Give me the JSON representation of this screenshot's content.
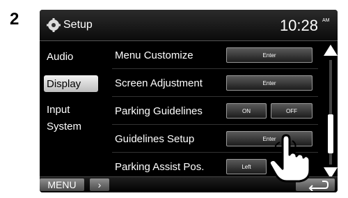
{
  "step": "2",
  "titlebar": {
    "title": "Setup",
    "time": "10:28",
    "ampm": "AM",
    "icon": "gear-icon"
  },
  "sidebar": {
    "items": [
      {
        "label": "Audio"
      },
      {
        "label": "Display",
        "selected": true
      },
      {
        "label": "Input"
      },
      {
        "label": "System"
      }
    ]
  },
  "list": {
    "rows": [
      {
        "label": "Menu Customize",
        "buttons": [
          "Enter"
        ]
      },
      {
        "label": "Screen Adjustment",
        "buttons": [
          "Enter"
        ]
      },
      {
        "label": "Parking Guidelines",
        "buttons": [
          "ON",
          "OFF"
        ]
      },
      {
        "label": "Guidelines Setup",
        "buttons": [
          "Enter"
        ]
      },
      {
        "label": "Parking Assist Pos.",
        "buttons": [
          "Left"
        ]
      }
    ]
  },
  "bottombar": {
    "menu_label": "MENU",
    "next_label": "›",
    "back_icon": "return-arrow-icon"
  }
}
